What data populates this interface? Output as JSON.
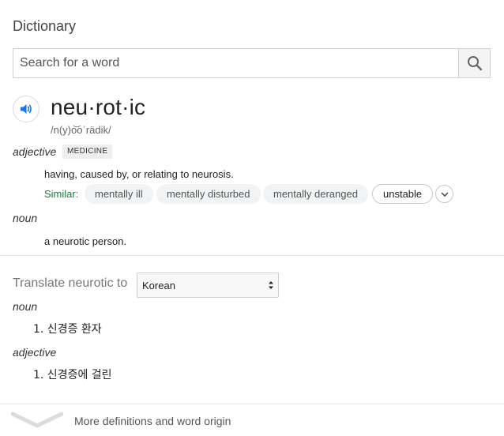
{
  "heading": "Dictionary",
  "search": {
    "placeholder": "Search for a word",
    "value": ""
  },
  "entry": {
    "word": "neu·rot·ic",
    "phonetic": "/n(y)o͝oˈrädik/",
    "senses": [
      {
        "pos": "adjective",
        "tag": "MEDICINE",
        "definition": "having, caused by, or relating to neurosis.",
        "similar_label": "Similar:",
        "similar": [
          "mentally ill",
          "mentally disturbed",
          "mentally deranged",
          "unstable"
        ]
      },
      {
        "pos": "noun",
        "definition": "a neurotic person."
      }
    ]
  },
  "translate": {
    "label": "Translate neurotic to",
    "language": "Korean",
    "results": [
      {
        "pos": "noun",
        "items": [
          "1. 신경증 환자"
        ]
      },
      {
        "pos": "adjective",
        "items": [
          "1. 신경증에 걸린"
        ]
      }
    ]
  },
  "more": {
    "label": "More definitions and word origin"
  },
  "icons": {
    "search": "search-icon",
    "speaker": "speaker-icon",
    "expand": "chevron-down-icon",
    "select": "select-arrows-icon",
    "more": "chevron-down-icon"
  },
  "colors": {
    "accent_blue": "#1a73e8",
    "similar_green": "#188038"
  }
}
